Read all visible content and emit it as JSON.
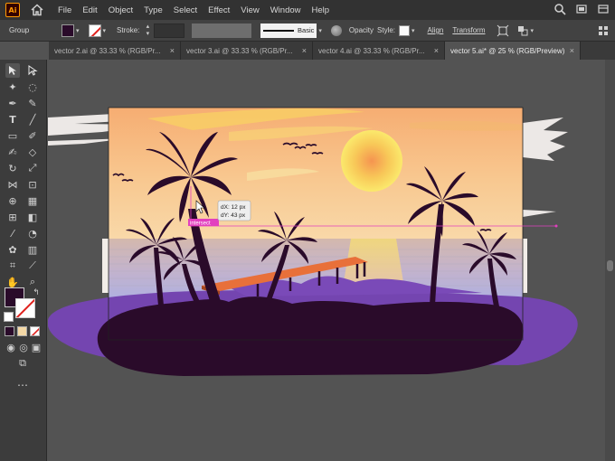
{
  "app": {
    "logo_text": "Ai",
    "menu": [
      "File",
      "Edit",
      "Object",
      "Type",
      "Select",
      "Effect",
      "View",
      "Window",
      "Help"
    ]
  },
  "control_bar": {
    "selection_label": "Group",
    "stroke_label": "Stroke:",
    "brush_label": "Basic",
    "opacity_label": "Opacity",
    "style_label": "Style:",
    "align_label": "Align",
    "transform_label": "Transform"
  },
  "tabs": [
    {
      "label": "vector 2.ai @ 33.33 % (RGB/Pr...",
      "active": false
    },
    {
      "label": "vector 3.ai @ 33.33 % (RGB/Pr...",
      "active": false
    },
    {
      "label": "vector 4.ai @ 33.33 % (RGB/Pr...",
      "active": false
    },
    {
      "label": "vector 5.ai* @ 25 % (RGB/Preview)",
      "active": true
    }
  ],
  "canvas": {
    "tooltip_dx": "dX: 12 px",
    "tooltip_dy": "dY: 43 px",
    "guide_label": "intersect"
  },
  "colors": {
    "fill": "#2a0b2a",
    "purple_shadow": "#7445b0",
    "guide": "#e23fbf",
    "dock": "#e8703a"
  }
}
